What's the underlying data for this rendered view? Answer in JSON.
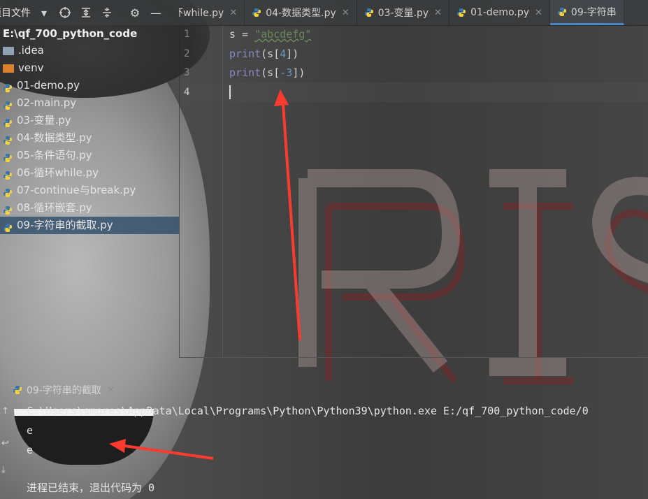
{
  "toolbar": {
    "project_label": "项目文件",
    "icons": [
      "chevron-down-icon",
      "locate-icon",
      "expand-all-icon",
      "collapse-all-icon",
      "gear-icon",
      "minimize-icon"
    ]
  },
  "tabs": [
    {
      "label": "循环while.py",
      "active": false
    },
    {
      "label": "04-数据类型.py",
      "active": false
    },
    {
      "label": "03-变量.py",
      "active": false
    },
    {
      "label": "01-demo.py",
      "active": false
    },
    {
      "label": "09-字符串",
      "active": true
    }
  ],
  "tree": {
    "root": "E:\\qf_700_python_code",
    "items": [
      {
        "label": ".idea",
        "type": "folder"
      },
      {
        "label": "venv",
        "type": "folder-excluded"
      },
      {
        "label": "01-demo.py",
        "type": "python"
      },
      {
        "label": "02-main.py",
        "type": "python"
      },
      {
        "label": "03-变量.py",
        "type": "python"
      },
      {
        "label": "04-数据类型.py",
        "type": "python"
      },
      {
        "label": "05-条件语句.py",
        "type": "python"
      },
      {
        "label": "06-循环while.py",
        "type": "python"
      },
      {
        "label": "07-continue与break.py",
        "type": "python"
      },
      {
        "label": "08-循环嵌套.py",
        "type": "python"
      },
      {
        "label": "09-字符串的截取.py",
        "type": "python",
        "selected": true
      }
    ]
  },
  "editor": {
    "line_numbers": [
      "1",
      "2",
      "3",
      "4"
    ],
    "line1": {
      "var": "s = ",
      "str": "\"abcdefg\""
    },
    "line2": {
      "fn": "print",
      "open": "(s[",
      "num": "4",
      "close": "])"
    },
    "line3": {
      "fn": "print",
      "open": "(s[",
      "num": "-3",
      "close": "])"
    }
  },
  "run": {
    "tab_label": "09-字符串的截取",
    "command": "C:\\Users\\smores\\AppData\\Local\\Programs\\Python\\Python39\\python.exe E:/qf_700_python_code/0",
    "output_lines": [
      "e",
      "e"
    ],
    "exit_message": "进程已结束，退出代码为 0"
  },
  "colors": {
    "accent": "#4a88c7",
    "annotation_arrow": "#ff3b30",
    "python_blue": "#3776ab",
    "python_yellow": "#ffd43b"
  }
}
